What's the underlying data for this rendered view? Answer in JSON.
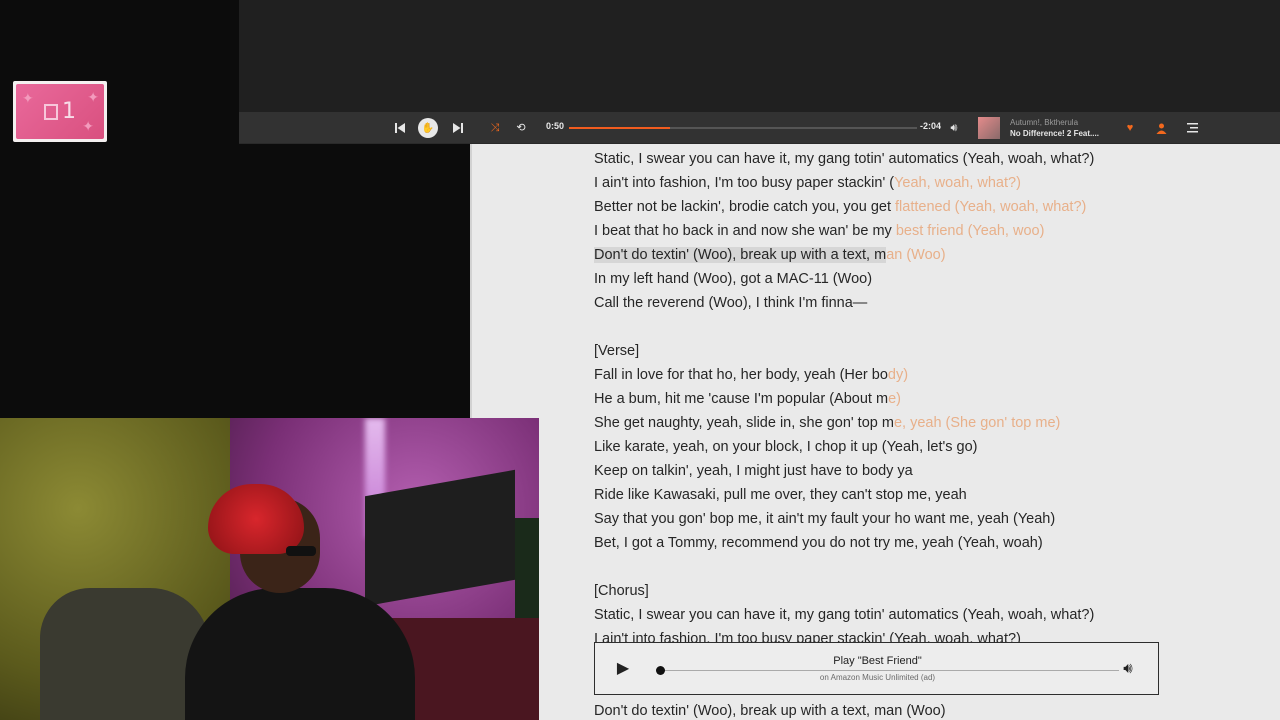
{
  "overlay_badge": {
    "text": "1"
  },
  "player": {
    "elapsed": "0:50",
    "remaining": "-2:04",
    "progress_fraction": 0.29,
    "artist": "Autumn!, Bktherula",
    "song": "No Difference! 2 Feat....",
    "accent_color": "#f2681d",
    "icons": [
      "skip-back-icon",
      "play-pause-icon",
      "skip-forward-icon",
      "shuffle-icon",
      "repeat-icon",
      "volume-icon",
      "heart-icon",
      "user-icon",
      "queue-icon"
    ]
  },
  "lyrics": [
    {
      "main": "Static, I swear you can have it, my gang totin' automatics (Yeah, woah, what?)",
      "fade": ""
    },
    {
      "main": "I ain't into fashion, I'm too busy paper stackin' (",
      "fade": "Yeah, woah, what?)"
    },
    {
      "main": "Better not be lackin', brodie catch you, you get ",
      "fade": "flattened (Yeah, woah, what?)"
    },
    {
      "main": "I beat that ho back in and now she wan' be my ",
      "fade": "best friend (Yeah, woo)"
    },
    {
      "main": "Don't do textin' (Woo), break up with a text, m",
      "fade": "an (Woo)",
      "highlight": true
    },
    {
      "main": "In my left hand (Woo), got a MAC-11 (Woo)",
      "fade": ""
    },
    {
      "main": "Call the reverend (Woo), I think I'm finna—",
      "fade": ""
    },
    {
      "main": "",
      "fade": ""
    },
    {
      "main": "[Verse]",
      "fade": ""
    },
    {
      "main": "Fall in love for that ho, her body, yeah (Her bo",
      "fade": "dy)"
    },
    {
      "main": "He a bum, hit me 'cause I'm popular (About m",
      "fade": "e)"
    },
    {
      "main": "She get naughty, yeah, slide in, she gon' top m",
      "fade": "e, yeah (She gon' top me)"
    },
    {
      "main": "Like karate, yeah, on your block, I chop it up (Yeah, let's go)",
      "fade": ""
    },
    {
      "main": "Keep on talkin', yeah, I might just have to body ya",
      "fade": ""
    },
    {
      "main": "Ride like Kawasaki, pull me over, they can't stop me, yeah",
      "fade": ""
    },
    {
      "main": "Say that you gon' bop me, it ain't my fault your ho want me, yeah (Yeah)",
      "fade": ""
    },
    {
      "main": "Bet, I got a Tommy, recommend you do not try me, yeah (Yeah, woah)",
      "fade": ""
    },
    {
      "main": "",
      "fade": ""
    },
    {
      "main": "[Chorus]",
      "fade": ""
    },
    {
      "main": "Static, I swear you can have it, my gang totin' automatics (Yeah, woah, what?)",
      "fade": ""
    },
    {
      "main": "I ain't into fashion, I'm too busy paper stackin' (Yeah, woah, what?)",
      "fade": ""
    }
  ],
  "last_line": "Don't do textin' (Woo), break up with a text, man (Woo)",
  "ad": {
    "title": "Play \"Best Friend\"",
    "subtitle": "on Amazon Music Unlimited (ad)"
  }
}
